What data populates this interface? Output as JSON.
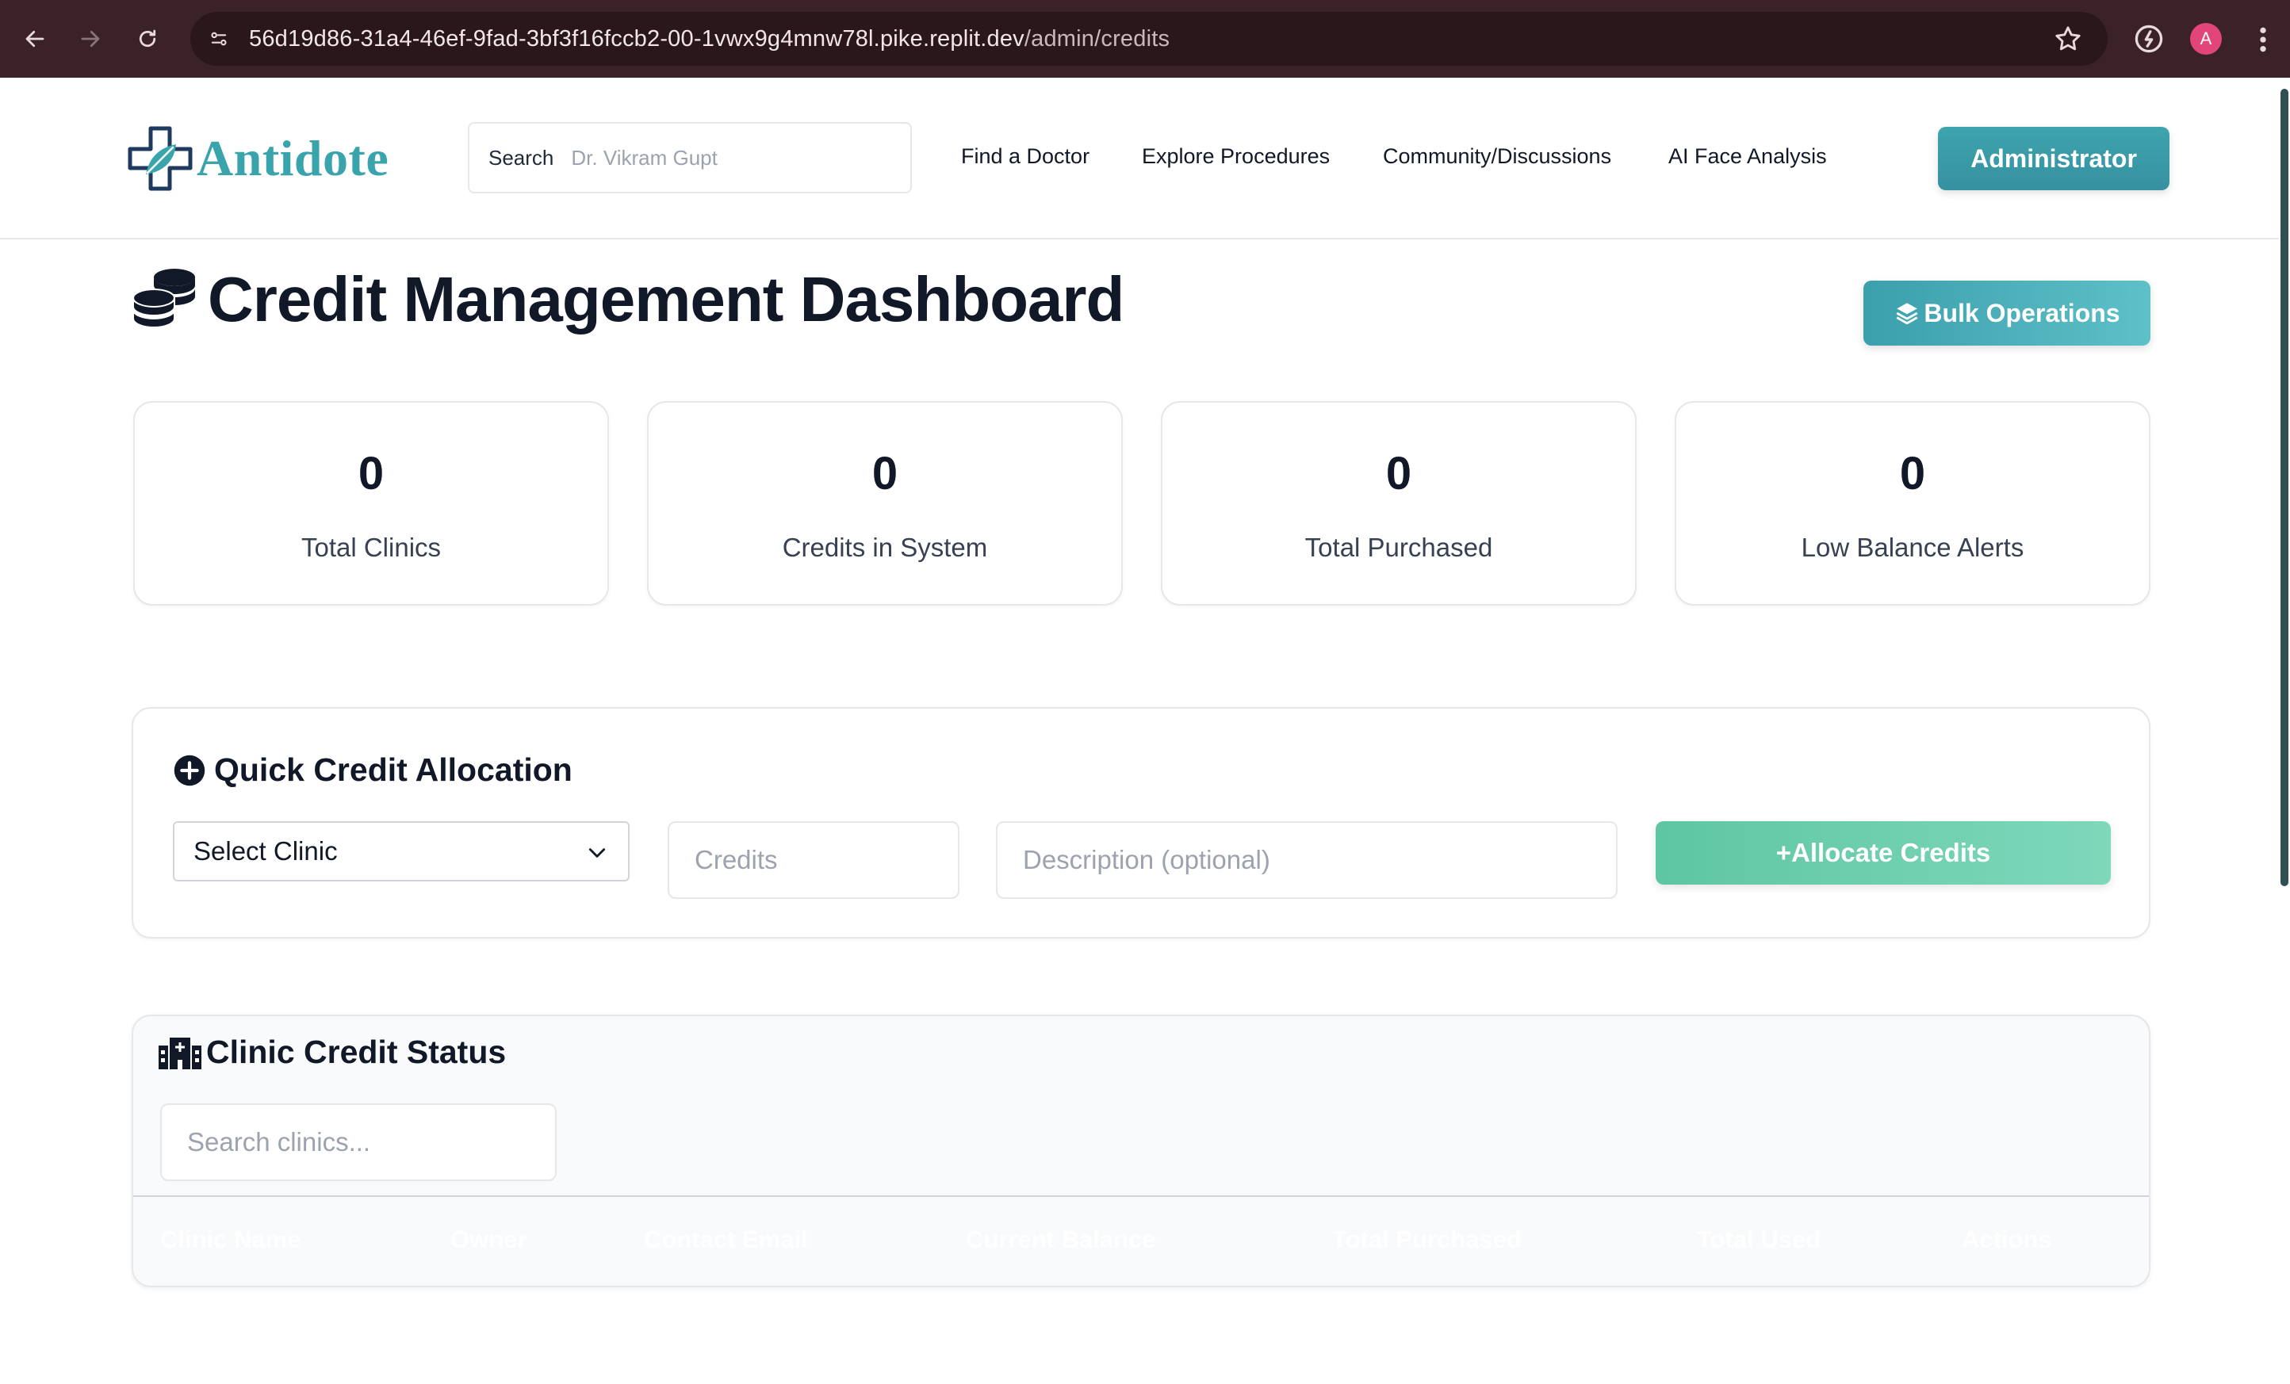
{
  "browser": {
    "url_main": "56d19d86-31a4-46ef-9fad-3bf3f16fccb2-00-1vwx9g4mnw78l.pike.replit.dev",
    "url_path": "/admin/credits",
    "profile_initial": "A"
  },
  "header": {
    "logo_text": "Antidote",
    "search_label": "Search",
    "search_placeholder": "Dr. Vikram Gupt",
    "nav": [
      {
        "label": "Find a Doctor"
      },
      {
        "label": "Explore Procedures"
      },
      {
        "label": "Community/Discussions"
      },
      {
        "label": "AI Face Analysis"
      }
    ],
    "admin_label": "Administrator"
  },
  "page": {
    "title": "Credit Management Dashboard",
    "bulk_label": "Bulk Operations"
  },
  "stats": [
    {
      "value": "0",
      "label": "Total Clinics"
    },
    {
      "value": "0",
      "label": "Credits in System"
    },
    {
      "value": "0",
      "label": "Total Purchased"
    },
    {
      "value": "0",
      "label": "Low Balance Alerts"
    }
  ],
  "allocation": {
    "title": "Quick Credit Allocation",
    "select_value": "Select Clinic",
    "credits_placeholder": "Credits",
    "description_placeholder": "Description (optional)",
    "button_label": "+Allocate Credits"
  },
  "status": {
    "title": "Clinic Credit Status",
    "search_placeholder": "Search clinics...",
    "columns": [
      "Clinic Name",
      "Owner",
      "Contact Email",
      "Current Balance",
      "Total Purchased",
      "Total Used",
      "Actions"
    ]
  },
  "colors": {
    "brand_teal": "#3aa4ac",
    "allocate_green": "#5ec6a2",
    "browser_frame": "#3b2228"
  }
}
